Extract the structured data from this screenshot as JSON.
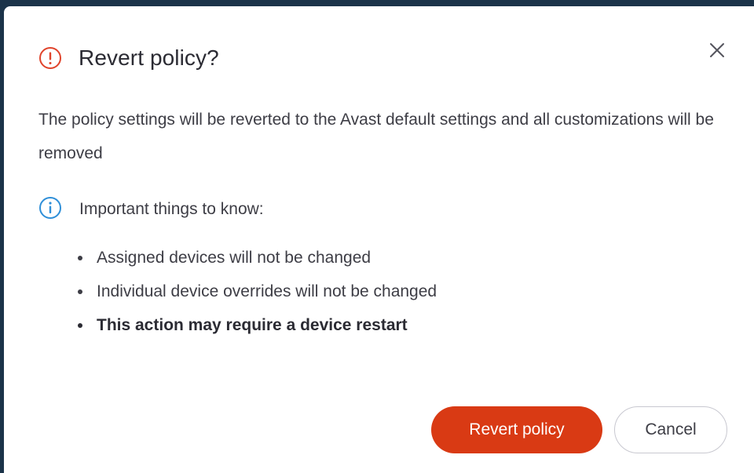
{
  "dialog": {
    "title": "Revert policy?",
    "description": "The policy settings will be reverted to the Avast default settings and all customizations will be removed",
    "info_label": "Important things to know:",
    "bullets": [
      "Assigned devices will not be changed",
      "Individual device overrides will not be changed",
      "This action may require a device restart"
    ],
    "primary_button": "Revert policy",
    "secondary_button": "Cancel"
  },
  "icons": {
    "alert": "alert-circle-icon",
    "info": "info-circle-icon",
    "close": "close-icon"
  },
  "colors": {
    "backdrop": "#1b3349",
    "alert_icon": "#e0442c",
    "info_icon": "#2f8fd8",
    "primary_button": "#d93a14",
    "text_primary": "#2b2b33",
    "text_body": "#3d3d45"
  }
}
